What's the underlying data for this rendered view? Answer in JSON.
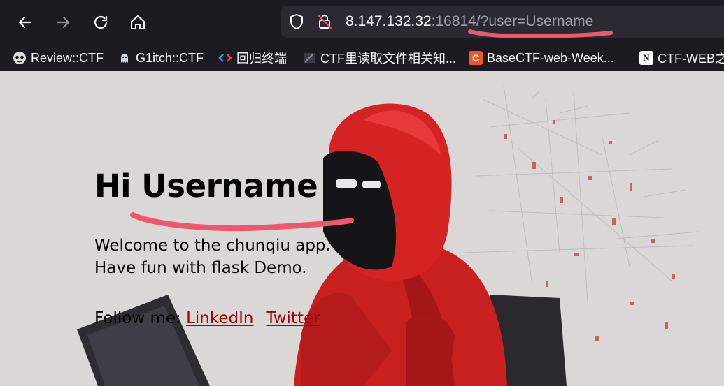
{
  "browser": {
    "url_host": "8.147.132.32",
    "url_port_path": ":16814/?user=Username",
    "bookmarks": [
      {
        "label": "Review::CTF",
        "icon": "globe-icon"
      },
      {
        "label": "G1itch::CTF",
        "icon": "ghost-icon"
      },
      {
        "label": "回归终端",
        "icon": "code-brackets-icon"
      },
      {
        "label": "CTF里读取文件相关知...",
        "icon": "folder-slash-icon"
      },
      {
        "label": "BaseCTF-web-Week...",
        "icon": "c-logo-icon"
      },
      {
        "label": "CTF-WEB之",
        "icon": "notion-icon"
      }
    ],
    "bookmark_icon_glyphs": {
      "c": "C",
      "n": "N"
    }
  },
  "page": {
    "greeting": "Hi Username",
    "welcome_line_1": "Welcome to the chunqiu app.",
    "welcome_line_2": "Have fun with flask Demo.",
    "follow_label": "Follow me: ",
    "link_linkedin": "LinkedIn",
    "link_twitter": "Twitter"
  },
  "colors": {
    "chrome_bg": "#1c1b22",
    "urlbar_bg": "#2b2a33",
    "page_bg": "#d9d8d6",
    "link": "#a60000",
    "annotation": "#f2566e",
    "hoodie": "#d42020"
  }
}
